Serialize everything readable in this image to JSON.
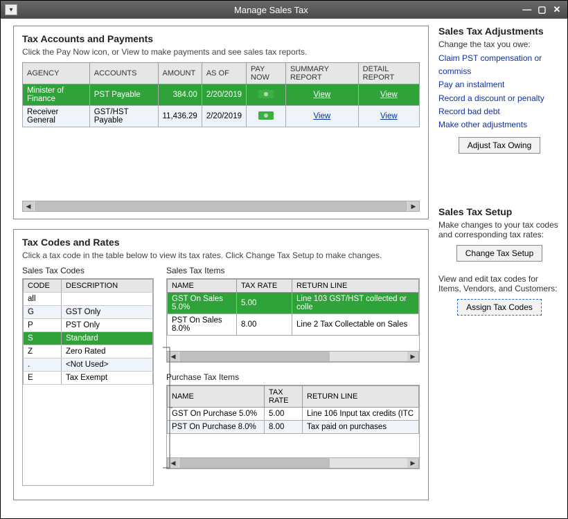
{
  "window": {
    "title": "Manage Sales Tax"
  },
  "accounts": {
    "heading": "Tax Accounts and Payments",
    "subtitle": "Click the Pay Now icon, or View to make payments and see sales tax reports.",
    "columns": [
      "AGENCY",
      "ACCOUNTS",
      "AMOUNT",
      "AS OF",
      "PAY NOW",
      "SUMMARY REPORT",
      "DETAIL REPORT"
    ],
    "rows": [
      {
        "agency": "Minister of Finance",
        "account": "PST Payable",
        "amount": "384.00",
        "asof": "2/20/2019",
        "summary": "View",
        "detail": "View",
        "selected": true
      },
      {
        "agency": "Receiver General",
        "account": "GST/HST Payable",
        "amount": "11,436.29",
        "asof": "2/20/2019",
        "summary": "View",
        "detail": "View",
        "selected": false
      }
    ]
  },
  "codes": {
    "heading": "Tax Codes and Rates",
    "subtitle": "Click a tax code in the table below to view its tax rates. Click Change Tax Setup to make changes.",
    "codes_label": "Sales Tax Codes",
    "codes_columns": [
      "CODE",
      "DESCRIPTION"
    ],
    "codes_rows": [
      {
        "code": "all",
        "description": ""
      },
      {
        "code": "G",
        "description": "GST Only",
        "alt": true
      },
      {
        "code": "P",
        "description": "PST Only"
      },
      {
        "code": "S",
        "description": "Standard",
        "selected": true
      },
      {
        "code": "Z",
        "description": "Zero Rated"
      },
      {
        "code": ".",
        "description": "<Not Used>",
        "alt": true
      },
      {
        "code": "E",
        "description": "Tax Exempt"
      }
    ],
    "sales_items_label": "Sales Tax Items",
    "sales_items_columns": [
      "NAME",
      "TAX RATE",
      "RETURN LINE"
    ],
    "sales_items_rows": [
      {
        "name": "GST On Sales 5.0%",
        "rate": "5.00",
        "return": "Line 103 GST/HST collected or colle",
        "selected": true
      },
      {
        "name": "PST On Sales 8.0%",
        "rate": "8.00",
        "return": "Line 2 Tax Collectable on Sales"
      }
    ],
    "purchase_items_label": "Purchase Tax Items",
    "purchase_items_columns": [
      "NAME",
      "TAX RATE",
      "RETURN LINE"
    ],
    "purchase_items_rows": [
      {
        "name": "GST On Purchase 5.0%",
        "rate": "5.00",
        "return": "Line 106 Input tax credits (ITC"
      },
      {
        "name": "PST On Purchase 8.0%",
        "rate": "8.00",
        "return": "Tax paid on purchases",
        "alt": true
      }
    ]
  },
  "side": {
    "adjustments": {
      "heading": "Sales Tax Adjustments",
      "note": "Change the tax you owe:",
      "links": [
        "Claim PST compensation or commiss",
        "Pay an instalment",
        "Record a discount or penalty",
        "Record bad debt",
        "Make other adjustments"
      ],
      "button": "Adjust Tax Owing"
    },
    "setup": {
      "heading": "Sales Tax Setup",
      "note": "Make changes to your tax codes and corresponding tax rates:",
      "button": "Change Tax Setup",
      "note2": "View and edit tax codes for Items, Vendors, and Customers:",
      "button2": "Assign Tax Codes"
    }
  }
}
